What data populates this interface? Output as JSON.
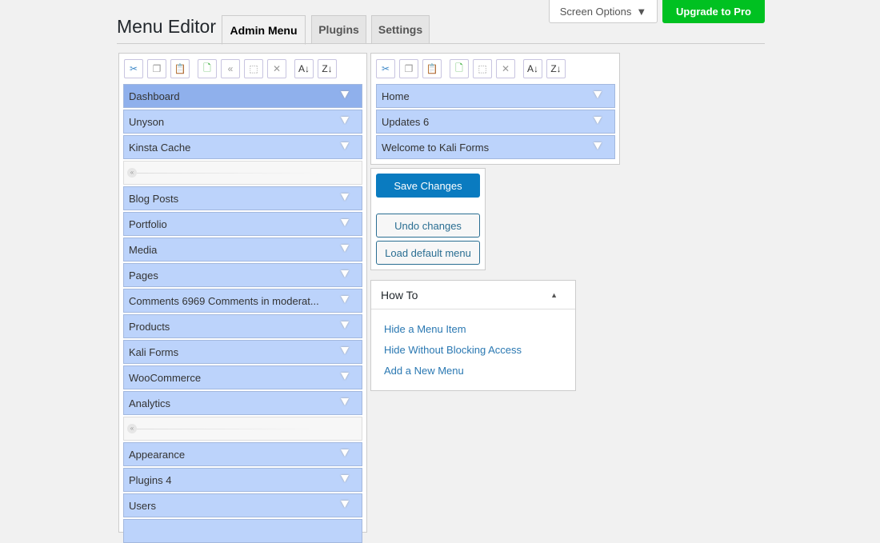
{
  "header": {
    "title": "Menu Editor",
    "tabs": [
      {
        "label": "Admin Menu",
        "active": true
      },
      {
        "label": "Plugins"
      },
      {
        "label": "Settings"
      }
    ],
    "screen_options": "Screen Options",
    "upgrade": "Upgrade to Pro"
  },
  "toolbar": {
    "left": [
      "cut",
      "copy",
      "paste",
      "new-menu",
      "new-separator",
      "toggle-hidden",
      "delete",
      "sort-ascending",
      "sort-descending"
    ],
    "right": [
      "cut",
      "copy",
      "paste",
      "new-item",
      "toggle-hidden",
      "delete",
      "sort-ascending",
      "sort-descending"
    ],
    "sort_asc": "A Z",
    "sort_desc": "Z A"
  },
  "menu_items": [
    "Dashboard",
    "Unyson",
    "Kinsta Cache",
    null,
    "Blog Posts",
    "Portfolio",
    "Media",
    "Pages",
    "Comments 6969 Comments in moderat...",
    "Products",
    "Kali Forms",
    "WooCommerce",
    "Analytics",
    null,
    "Appearance",
    "Plugins 4",
    "Users",
    ""
  ],
  "submenu_items": [
    "Home",
    "Updates 6",
    "Welcome to Kali Forms"
  ],
  "actions": {
    "save": "Save Changes",
    "undo": "Undo changes",
    "load_default": "Load default menu"
  },
  "howto": {
    "title": "How To",
    "links": [
      "Hide a Menu Item",
      "Hide Without Blocking Access",
      "Add a New Menu"
    ]
  },
  "colors": {
    "item": "#bcd3fb",
    "selected": "#8fb0ec",
    "primary": "#0a7bc0",
    "upgrade": "#00c121"
  }
}
